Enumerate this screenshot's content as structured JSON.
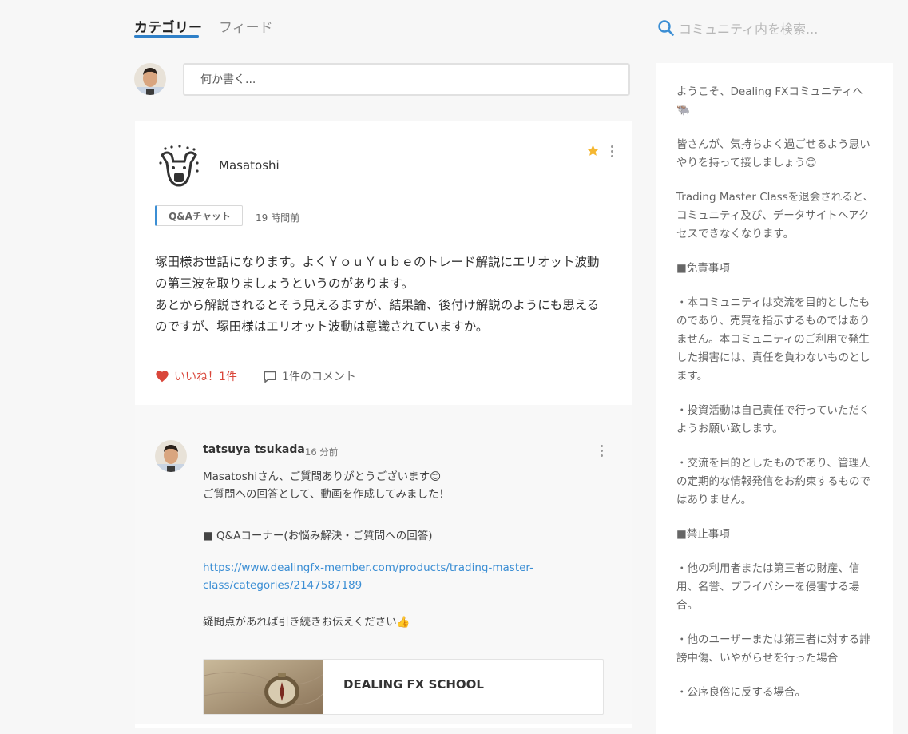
{
  "tabs": [
    {
      "label": "カテゴリー",
      "active": true
    },
    {
      "label": "フィード",
      "active": false
    }
  ],
  "search": {
    "placeholder": "コミュニティ内を検索..."
  },
  "compose": {
    "placeholder": "何か書く..."
  },
  "post": {
    "author": "Masatoshi",
    "category": "Q&Aチャット",
    "time": "19 時間前",
    "body": [
      "塚田様お世話になります。よくＹｏｕＹｕｂｅのトレード解説にエリオット波動の第三波を取りましょうというのがあります。",
      "あとから解説されるとそう見えるますが、結果論、後付け解説のようにも思えるのですが、塚田様はエリオット波動は意識されていますか。"
    ],
    "like_label": "いいね！1件",
    "comment_label": "1件のコメント"
  },
  "comment": {
    "author": "tatsuya tsukada",
    "time": "16 分前",
    "line1": "Masatoshiさん、ご質問ありがとうございます😊",
    "line2": "ご質問への回答として、動画を作成してみました！",
    "section": "■ Q&Aコーナー(お悩み解決・ご質問への回答)",
    "link_line1": "https://www.dealingfx-member.com/products/trading-master-",
    "link_line2": "class/categories/2147587189",
    "closing": "疑問点があれば引き続きお伝えください👍",
    "link_card_title": "DEALING FX SCHOOL"
  },
  "sidebar": {
    "welcome": "ようこそ、Dealing FXコミュニティへ",
    "welcome_emoji": "🐃",
    "p1": "皆さんが、気持ちよく過ごせるよう思いやりを持って接しましょう😊",
    "p2": "Trading Master Classを退会されると、コミュニティ及び、データサイトへアクセスできなくなります。",
    "h1": "■免責事項",
    "p3": "・本コミュニティは交流を目的としたものであり、売買を指示するものではありません。本コミュニティのご利用で発生した損害には、責任を負わないものとします。",
    "p4": "・投資活動は自己責任で行っていただくようお願い致します。",
    "p5": "・交流を目的としたものであり、管理人の定期的な情報発信をお約束するものではありません。",
    "h2": "■禁止事項",
    "p6": "・他の利用者または第三者の財産、信用、名誉、プライバシーを侵害する場合。",
    "p7": "・他のユーザーまたは第三者に対する誹謗中傷、いやがらせを行った場合",
    "p8": "・公序良俗に反する場合。"
  },
  "colors": {
    "accent": "#2f80c8",
    "like": "#d9463a",
    "star": "#f5b731"
  }
}
